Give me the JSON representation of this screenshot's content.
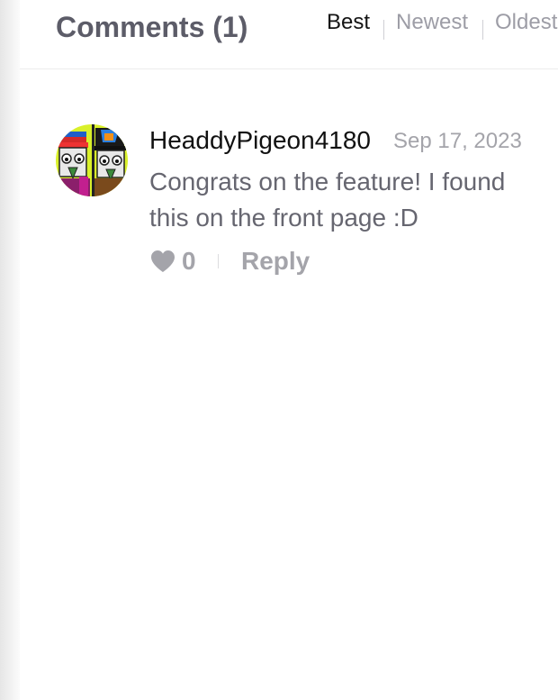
{
  "header": {
    "title": "Comments (1)",
    "sort_tabs": [
      {
        "label": "Best",
        "active": true
      },
      {
        "label": "Newest",
        "active": false
      },
      {
        "label": "Oldest",
        "active": false
      }
    ]
  },
  "comments": [
    {
      "author": "HeaddyPigeon4180",
      "date": "Sep 17, 2023",
      "text": "Congrats on the feature! I found this on the front page :D",
      "likes": "0",
      "reply_label": "Reply",
      "avatar_icon": "pigeon-avatar",
      "like_icon": "heart-icon"
    }
  ],
  "colors": {
    "title": "#5c5c68",
    "active_tab": "#141414",
    "inactive_tab": "#9d9da6",
    "author": "#111111",
    "muted": "#a4a4aa",
    "body_text": "#666670",
    "avatar_bg": "#d9f02a"
  }
}
